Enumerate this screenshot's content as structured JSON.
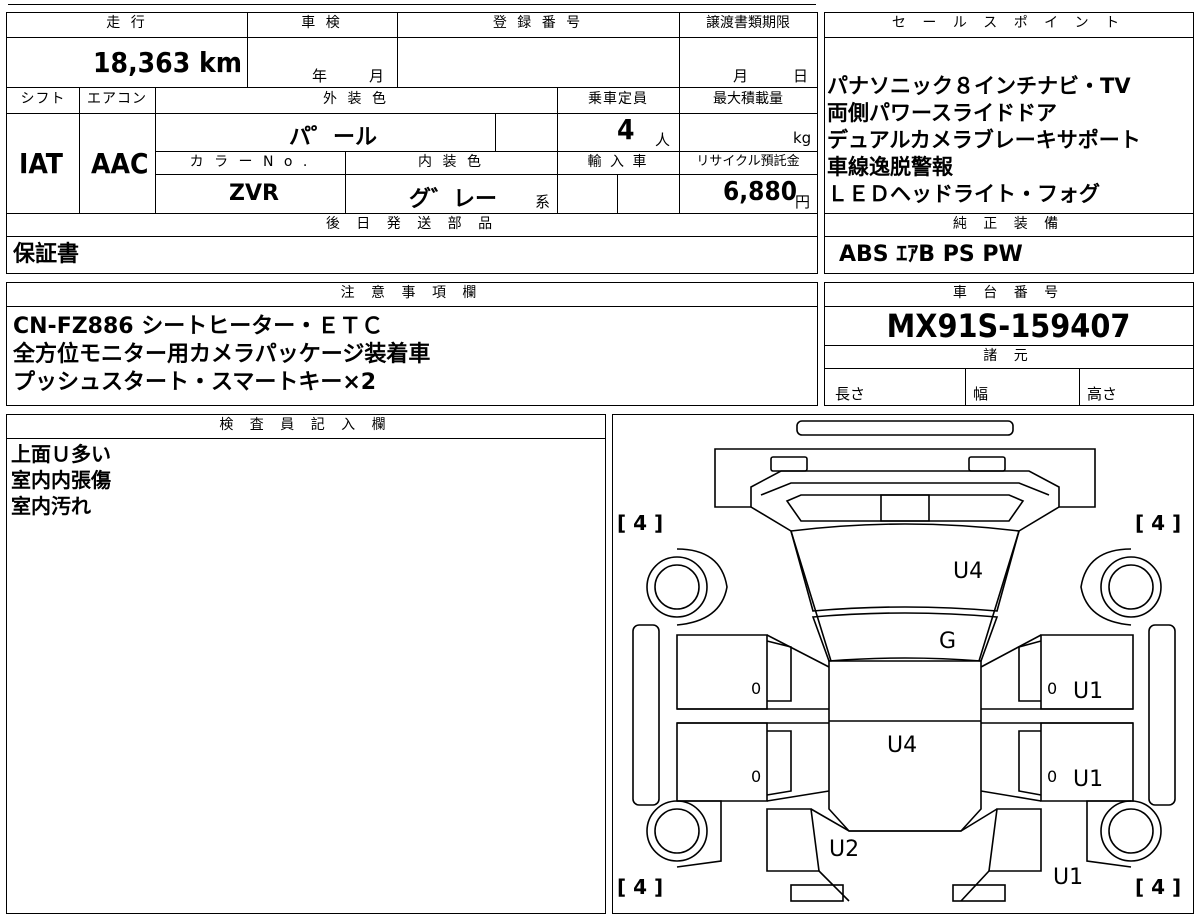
{
  "header": {
    "mileage_label": "走 行",
    "mileage_value": "18,363 km",
    "inspection_label": "車 検",
    "inspection_year": "年",
    "inspection_month": "月",
    "registration_label": "登 録 番 号",
    "transfer_label": "譲渡書類期限",
    "transfer_month": "月",
    "transfer_day": "日"
  },
  "row2": {
    "shift_label": "シフト",
    "shift_value": "IAT",
    "aircon_label": "エアコン",
    "aircon_value": "AAC",
    "exterior_label": "外 装 色",
    "exterior_value": "パ゜ール",
    "capacity_label": "乗車定員",
    "capacity_value": "4",
    "capacity_unit": "人",
    "load_label": "最大積載量",
    "load_unit": "kg",
    "color_no_label": "カ ラ ー N o .",
    "color_no_value": "ZVR",
    "interior_label": "内 装 色",
    "interior_value": "グ゛レー",
    "interior_suffix": "系",
    "import_label": "輸 入 車",
    "recycle_label": "リサイクル預託金",
    "recycle_value": "6,880",
    "recycle_unit": "円"
  },
  "later_parts": {
    "label": "後 日 発 送 部 品",
    "value": "保証書"
  },
  "sales_points": {
    "label": "セ ー ル ス ポ イ ン ト",
    "lines": [
      "パナソニック８インチナビ・TV",
      "両側パワースライドドア",
      "デュアルカメラブレーキサポート",
      "車線逸脱警報",
      "ＬＥＤヘッドライト・フォグ"
    ]
  },
  "genuine_equipment": {
    "label": "純 正 装 備",
    "value": "ABS  ｴｱB  PS  PW"
  },
  "notes": {
    "label": "注 意 事 項 欄",
    "lines": [
      "CN-FZ886  シートヒーター・ＥＴＣ",
      "全方位モニター用カメラパッケージ装着車",
      "プッシュスタート・スマートキー×2"
    ]
  },
  "chassis": {
    "label": "車 台 番 号",
    "value": "MX91S-159407",
    "spec_label": "諸 元",
    "length_label": "長さ",
    "width_label": "幅",
    "height_label": "高さ"
  },
  "inspector": {
    "label": "検 査 員 記 入 欄",
    "lines": [
      "上面Ｕ多い",
      "室内内張傷",
      "室内汚れ"
    ]
  },
  "diagram": {
    "tire_marks": [
      "[ 4 ]",
      "[ 4 ]",
      "[ 4 ]",
      "[ 4 ]"
    ],
    "marks": {
      "hood": "U4",
      "windshield": "G",
      "roof": "U4",
      "rear": "U2",
      "right_front_door": "U1",
      "right_rear_door": "U1",
      "right_rear": "U1",
      "zero": "0"
    }
  }
}
